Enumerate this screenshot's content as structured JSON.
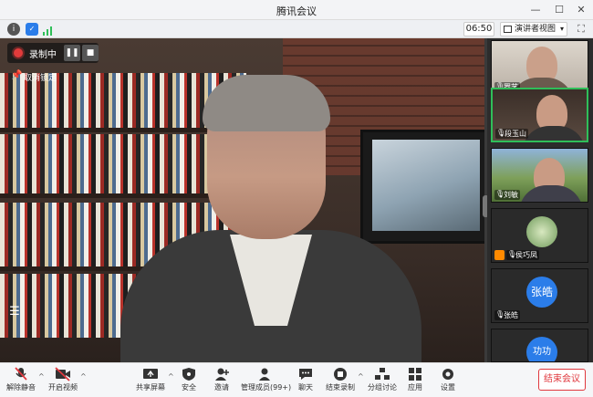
{
  "window": {
    "title": "腾讯会议"
  },
  "infobar": {
    "meeting_time": "06:50",
    "view_mode_label": "演讲者视图"
  },
  "main": {
    "recording_label": "录制中",
    "unpin_label": "取消锁定"
  },
  "participants": [
    {
      "name": "罗艺",
      "type": "video"
    },
    {
      "name": "段玉山",
      "type": "video",
      "active": true
    },
    {
      "name": "刘敏",
      "type": "video"
    },
    {
      "name": "侯巧凤",
      "type": "image"
    },
    {
      "name": "张皓",
      "type": "avatar",
      "avatar_text": "张皓"
    },
    {
      "name": "",
      "type": "avatar",
      "avatar_text": "功功"
    }
  ],
  "toolbar": {
    "unmute": "解除静音",
    "start_video": "开启视频",
    "share_screen": "共享屏幕",
    "security": "安全",
    "invite": "邀请",
    "manage_members": "管理成员(99+)",
    "chat": "聊天",
    "end_recording": "结束录制",
    "breakout": "分组讨论",
    "apps": "应用",
    "settings": "设置",
    "end_meeting": "结束会议"
  },
  "colors": {
    "end_red": "#e0383e",
    "record_red": "#e23b3b",
    "active_green": "#2fbf59",
    "avatar_blue": "#2b7de9"
  }
}
